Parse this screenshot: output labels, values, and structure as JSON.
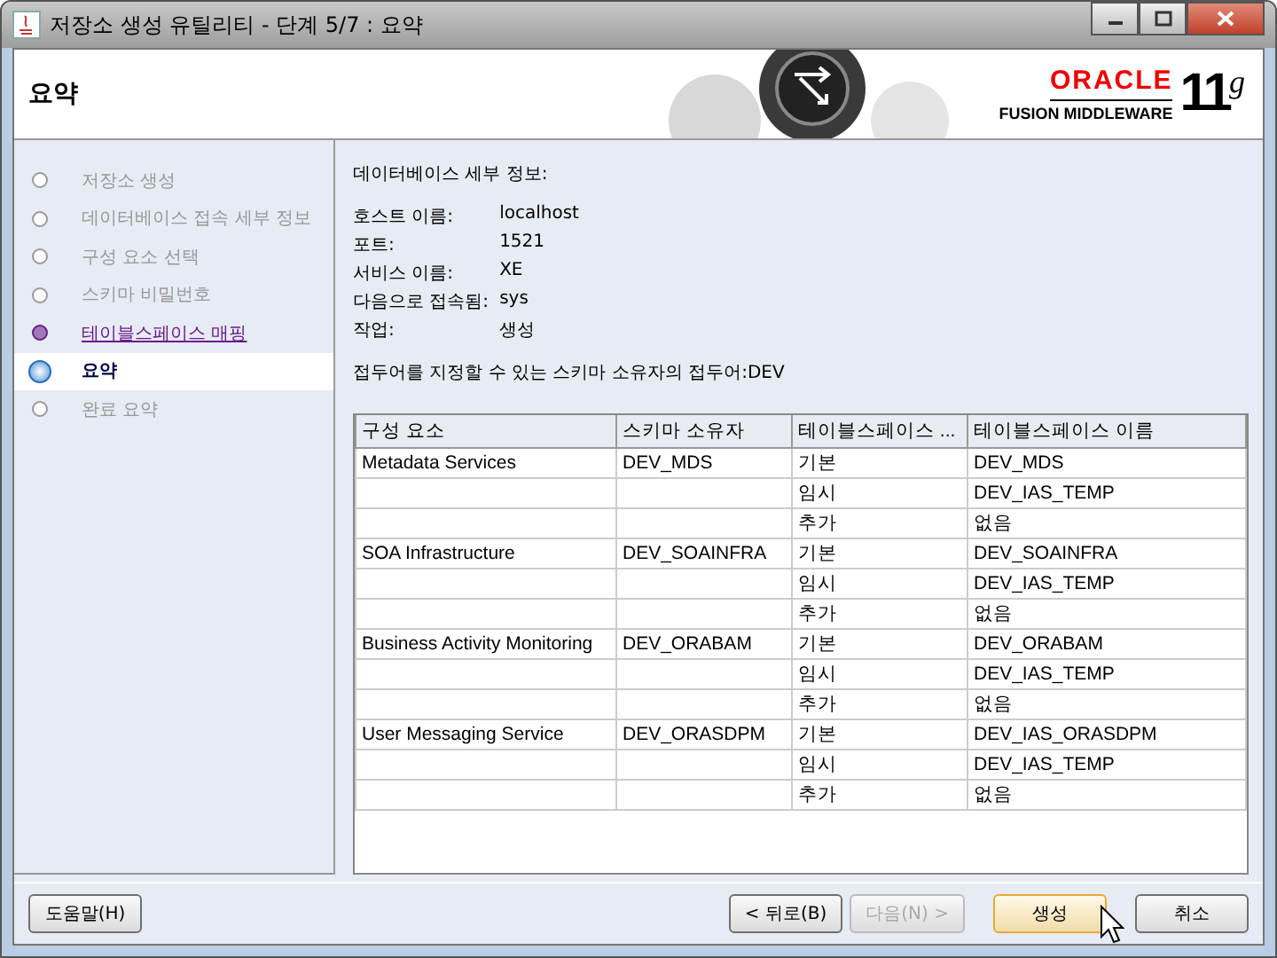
{
  "window": {
    "title": "저장소 생성 유틸리티 - 단계 5/7 : 요약"
  },
  "header": {
    "title": "요약",
    "brand": "ORACLE",
    "product": "FUSION MIDDLEWARE",
    "version": "11",
    "version_suffix": "g"
  },
  "steps": [
    {
      "label": "저장소 생성",
      "kind": "visited",
      "selected": false
    },
    {
      "label": "데이터베이스 접속 세부 정보",
      "kind": "visited",
      "selected": false
    },
    {
      "label": "구성 요소 선택",
      "kind": "visited",
      "selected": false
    },
    {
      "label": "스키마 비밀번호",
      "kind": "visited",
      "selected": false
    },
    {
      "label": "테이블스페이스 매핑",
      "kind": "link",
      "selected": false
    },
    {
      "label": "요약",
      "kind": "current",
      "selected": true
    },
    {
      "label": "완료 요약",
      "kind": "pending",
      "selected": false
    }
  ],
  "details": {
    "heading": "데이터베이스 세부 정보:",
    "fields": [
      {
        "label": "호스트 이름:",
        "value": "localhost"
      },
      {
        "label": "포트:",
        "value": "1521"
      },
      {
        "label": "서비스 이름:",
        "value": "XE"
      },
      {
        "label": "다음으로 접속됨:",
        "value": "sys"
      },
      {
        "label": "작업:",
        "value": "생성"
      }
    ],
    "note": "접두어를 지정할 수 있는 스키마 소유자의 접두어:DEV"
  },
  "table": {
    "columns": [
      "구성 요소",
      "스키마 소유자",
      "테이블스페이스 ...",
      "테이블스페이스 이름"
    ],
    "rows": [
      [
        "Metadata Services",
        "DEV_MDS",
        "기본",
        "DEV_MDS"
      ],
      [
        "",
        "",
        "임시",
        "DEV_IAS_TEMP"
      ],
      [
        "",
        "",
        "추가",
        "없음"
      ],
      [
        "SOA Infrastructure",
        "DEV_SOAINFRA",
        "기본",
        "DEV_SOAINFRA"
      ],
      [
        "",
        "",
        "임시",
        "DEV_IAS_TEMP"
      ],
      [
        "",
        "",
        "추가",
        "없음"
      ],
      [
        "Business Activity Monitoring",
        "DEV_ORABAM",
        "기본",
        "DEV_ORABAM"
      ],
      [
        "",
        "",
        "임시",
        "DEV_IAS_TEMP"
      ],
      [
        "",
        "",
        "추가",
        "없음"
      ],
      [
        "User Messaging Service",
        "DEV_ORASDPM",
        "기본",
        "DEV_IAS_ORASDPM"
      ],
      [
        "",
        "",
        "임시",
        "DEV_IAS_TEMP"
      ],
      [
        "",
        "",
        "추가",
        "없음"
      ]
    ]
  },
  "buttons": [
    {
      "label": "도움말(H)",
      "disabled": false,
      "focused": false
    },
    {
      "label": "< 뒤로(B)",
      "disabled": false,
      "focused": false
    },
    {
      "label": "다음(N) >",
      "disabled": true,
      "focused": false
    },
    {
      "label": "생성",
      "disabled": false,
      "focused": true
    },
    {
      "label": "취소",
      "disabled": false,
      "focused": false
    }
  ]
}
